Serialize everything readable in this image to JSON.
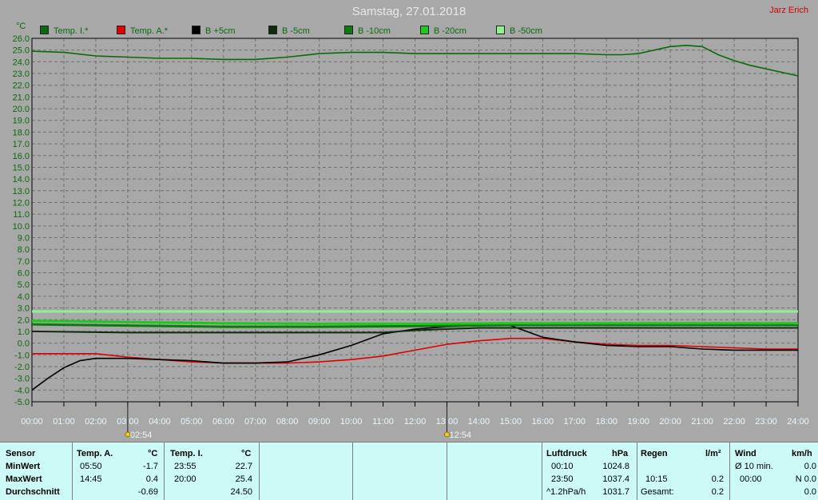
{
  "title": "Samstag, 27.01.2018",
  "author": "Jarz Erich",
  "colors": {
    "background": "#a8a8a8",
    "plot": "#a8a8a8",
    "grid": "#707070",
    "table": "#ccfaf6"
  },
  "legend": [
    {
      "label": "Temp. I.*",
      "color": "#0a6a0a"
    },
    {
      "label": "Temp. A.*",
      "color": "#e00000"
    },
    {
      "label": "B +5cm",
      "color": "#000000"
    },
    {
      "label": "B -5cm",
      "color": "#0c2e0c"
    },
    {
      "label": "B -10cm",
      "color": "#0e7a0e"
    },
    {
      "label": "B -20cm",
      "color": "#1ec81e"
    },
    {
      "label": "B -50cm",
      "color": "#8ef08e"
    }
  ],
  "chart_data": {
    "type": "line",
    "ylabel": "°C",
    "ylim": [
      -5.0,
      26.0
    ],
    "ystep": 1.0,
    "xlim": [
      0,
      24
    ],
    "x_ticks": [
      "00:00",
      "01:00",
      "02:00",
      "03:00",
      "04:00",
      "05:00",
      "06:00",
      "07:00",
      "08:00",
      "09:00",
      "10:00",
      "11:00",
      "12:00",
      "13:00",
      "14:00",
      "15:00",
      "16:00",
      "17:00",
      "18:00",
      "19:00",
      "20:00",
      "21:00",
      "22:00",
      "23:00",
      "24:00"
    ],
    "x_markers": [
      {
        "time": 3,
        "label": "02:54"
      },
      {
        "time": 13,
        "label": "12:54"
      }
    ],
    "grid": true,
    "series": [
      {
        "name": "Temp. I.*",
        "color": "#0a6a0a",
        "width": 1.6,
        "x": [
          0,
          1,
          2,
          3,
          4,
          5,
          6,
          7,
          8,
          9,
          10,
          11,
          12,
          13,
          14,
          15,
          16,
          17,
          18,
          18.5,
          19,
          19.5,
          20,
          20.5,
          21,
          21.5,
          22,
          22.5,
          23,
          23.5,
          24
        ],
        "y": [
          24.9,
          24.8,
          24.5,
          24.4,
          24.3,
          24.3,
          24.2,
          24.2,
          24.4,
          24.7,
          24.8,
          24.8,
          24.7,
          24.7,
          24.7,
          24.7,
          24.7,
          24.7,
          24.6,
          24.6,
          24.7,
          25.0,
          25.3,
          25.4,
          25.3,
          24.6,
          24.1,
          23.7,
          23.4,
          23.1,
          22.8
        ]
      },
      {
        "name": "Temp. A.*",
        "color": "#e00000",
        "width": 1.6,
        "x": [
          0,
          1,
          2,
          3,
          4,
          5,
          6,
          7,
          8,
          9,
          10,
          11,
          12,
          13,
          14,
          15,
          16,
          17,
          18,
          19,
          20,
          21,
          22,
          23,
          24
        ],
        "y": [
          -0.9,
          -0.9,
          -0.9,
          -1.2,
          -1.4,
          -1.6,
          -1.7,
          -1.7,
          -1.7,
          -1.6,
          -1.4,
          -1.1,
          -0.6,
          -0.1,
          0.2,
          0.4,
          0.4,
          0.1,
          -0.1,
          -0.2,
          -0.2,
          -0.3,
          -0.4,
          -0.5,
          -0.5
        ]
      },
      {
        "name": "B +5cm",
        "color": "#000000",
        "width": 1.6,
        "x": [
          0,
          0.5,
          1,
          1.5,
          2,
          2.5,
          3,
          4,
          5,
          6,
          7,
          8,
          9,
          10,
          11,
          12,
          13,
          14,
          15,
          16,
          16.5,
          17,
          18,
          19,
          20,
          21,
          22,
          23,
          24
        ],
        "y": [
          -4.0,
          -3.0,
          -2.1,
          -1.5,
          -1.3,
          -1.3,
          -1.3,
          -1.4,
          -1.5,
          -1.7,
          -1.7,
          -1.6,
          -1.0,
          -0.2,
          0.8,
          1.2,
          1.4,
          1.5,
          1.5,
          0.5,
          0.3,
          0.1,
          -0.2,
          -0.3,
          -0.3,
          -0.5,
          -0.6,
          -0.6,
          -0.6
        ]
      },
      {
        "name": "B -5cm",
        "color": "#0c2e0c",
        "width": 2,
        "x": [
          0,
          3,
          7,
          11,
          12,
          14,
          17,
          20,
          24
        ],
        "y": [
          1.0,
          0.9,
          0.9,
          0.9,
          1.1,
          1.3,
          1.3,
          1.3,
          1.3
        ]
      },
      {
        "name": "B -10cm",
        "color": "#0e7a0e",
        "width": 3,
        "x": [
          0,
          3,
          6,
          9,
          12,
          15,
          18,
          21,
          24
        ],
        "y": [
          1.6,
          1.5,
          1.4,
          1.4,
          1.45,
          1.55,
          1.55,
          1.55,
          1.55
        ]
      },
      {
        "name": "B -20cm",
        "color": "#1ec81e",
        "width": 3,
        "x": [
          0,
          3,
          6,
          9,
          12,
          15,
          18,
          21,
          24
        ],
        "y": [
          1.9,
          1.8,
          1.7,
          1.65,
          1.65,
          1.7,
          1.7,
          1.7,
          1.7
        ]
      },
      {
        "name": "B -50cm",
        "color": "#8ef08e",
        "width": 3,
        "x": [
          0,
          24
        ],
        "y": [
          2.7,
          2.7
        ]
      }
    ]
  },
  "table": {
    "sensor": {
      "header": "Sensor",
      "rows": [
        "MinWert",
        "MaxWert",
        "Durchschnitt"
      ]
    },
    "temp_a": {
      "header": "Temp. A.",
      "unit": "°C",
      "rows": [
        [
          "05:50",
          "-1.7"
        ],
        [
          "14:45",
          "0.4"
        ],
        [
          "",
          "-0.69"
        ]
      ]
    },
    "temp_i": {
      "header": "Temp. I.",
      "unit": "°C",
      "rows": [
        [
          "23:55",
          "22.7"
        ],
        [
          "20:00",
          "25.4"
        ],
        [
          "",
          "24.50"
        ]
      ]
    },
    "luftdruck": {
      "header": "Luftdruck",
      "unit": "hPa",
      "rows": [
        [
          "00:10",
          "1024.8"
        ],
        [
          "23:50",
          "1037.4"
        ],
        [
          "^1.2hPa/h",
          "1031.7"
        ]
      ]
    },
    "regen": {
      "header": "Regen",
      "unit": "l/m²",
      "rows": [
        [
          "",
          ""
        ],
        [
          "10:15",
          "0.2"
        ],
        [
          "Gesamt:",
          "0.2"
        ]
      ]
    },
    "wind": {
      "header": "Wind",
      "unit": "km/h",
      "rows": [
        [
          "Ø 10 min.",
          "0.0"
        ],
        [
          "00:00",
          "N 0.0"
        ],
        [
          "",
          "0.0"
        ]
      ]
    }
  }
}
